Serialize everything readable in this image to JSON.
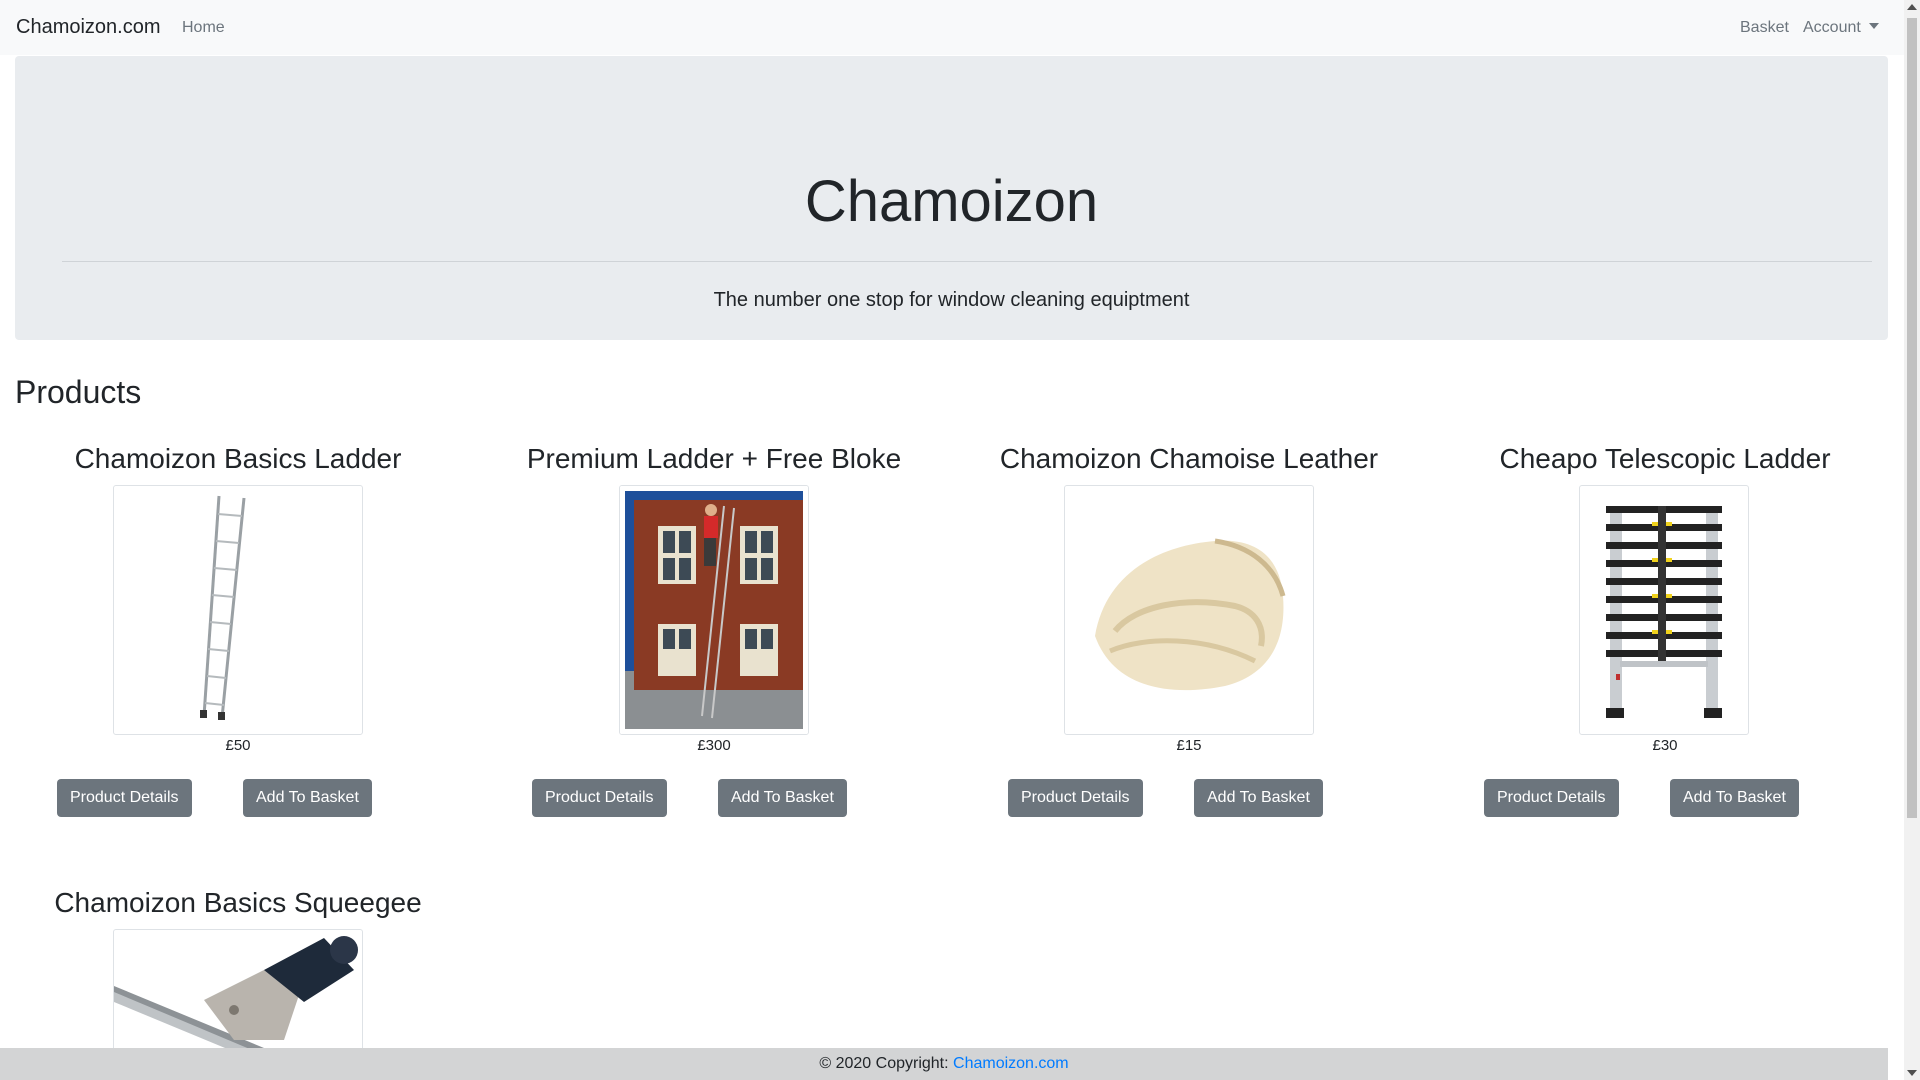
{
  "navbar": {
    "brand": "Chamoizon.com",
    "home": "Home",
    "basket": "Basket",
    "account": "Account"
  },
  "jumbotron": {
    "title": "Chamoizon",
    "lead": "The number one stop for window cleaning equiptment"
  },
  "products_heading": "Products",
  "products": [
    {
      "title": "Chamoizon Basics Ladder",
      "price": "£50",
      "details_label": "Product Details",
      "basket_label": "Add To Basket",
      "image": "ladder-image"
    },
    {
      "title": "Premium Ladder + Free Bloke",
      "price": "£300",
      "details_label": "Product Details",
      "basket_label": "Add To Basket",
      "image": "man-on-ladder-image"
    },
    {
      "title": "Chamoizon Chamoise Leather",
      "price": "£15",
      "details_label": "Product Details",
      "basket_label": "Add To Basket",
      "image": "chamois-leather-image"
    },
    {
      "title": "Cheapo Telescopic Ladder",
      "price": "£30",
      "details_label": "Product Details",
      "basket_label": "Add To Basket",
      "image": "telescopic-ladder-image"
    },
    {
      "title": "Chamoizon Basics Squeegee",
      "image": "squeegee-image"
    }
  ],
  "footer": {
    "prefix": "© 2020 Copyright: ",
    "link": "Chamoizon.com"
  },
  "colors": {
    "navbar_bg": "#f8f9fa",
    "jumbotron_bg": "#e9ecef",
    "button_bg": "#6c757d",
    "link": "#007bff",
    "footer_bg": "#d3d4d5"
  }
}
